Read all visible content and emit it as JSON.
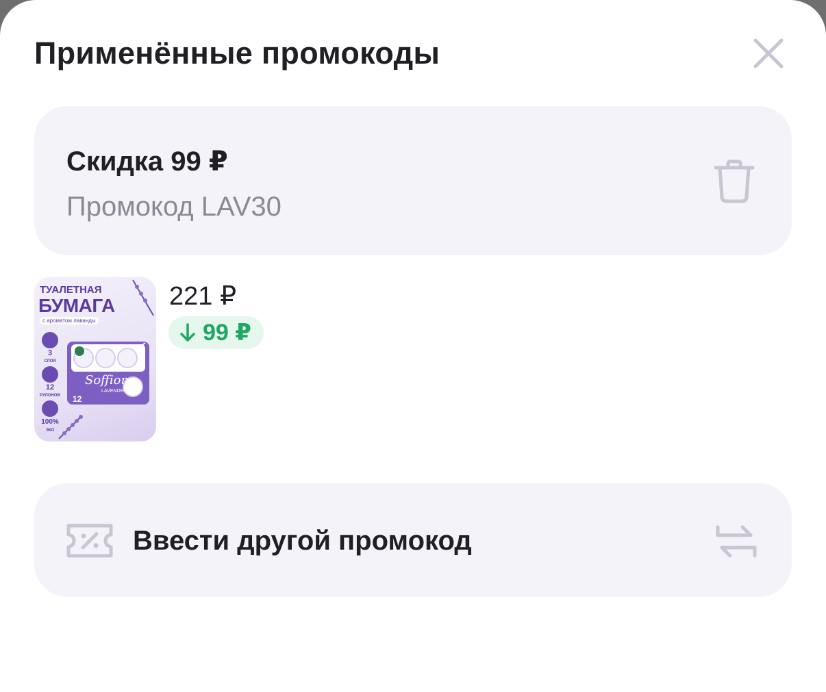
{
  "header": {
    "title": "Применённые промокоды"
  },
  "applied_promo": {
    "title": "Скидка 99 ₽",
    "code_text": "Промокод LAV30"
  },
  "product": {
    "image_texts": {
      "line1": "ТУАЛЕТНАЯ",
      "line2": "БУМАГА",
      "sub": "с ароматом лаванды",
      "layers": "3",
      "layers_label": "СЛОЯ",
      "rolls": "12",
      "rolls_label": "РУЛОНОВ",
      "eco": "100%",
      "eco_label": "ЭКО",
      "brand": "Soffione",
      "variant": "LAVENDER",
      "pack_count": "12"
    },
    "price": "221 ₽",
    "discount": "99 ₽"
  },
  "enter_other": {
    "label": "Ввести другой промокод"
  },
  "icons": {
    "close": "close-icon",
    "trash": "trash-icon",
    "arrow_down": "arrow-down-icon",
    "coupon": "coupon-icon",
    "swap": "swap-icon"
  },
  "colors": {
    "card_bg": "#f4f3fa",
    "text_primary": "#1f1f24",
    "text_secondary": "#8a8a96",
    "icon_gray": "#c7c6d2",
    "discount_green": "#21a663",
    "discount_bg": "#e6f7ee"
  }
}
